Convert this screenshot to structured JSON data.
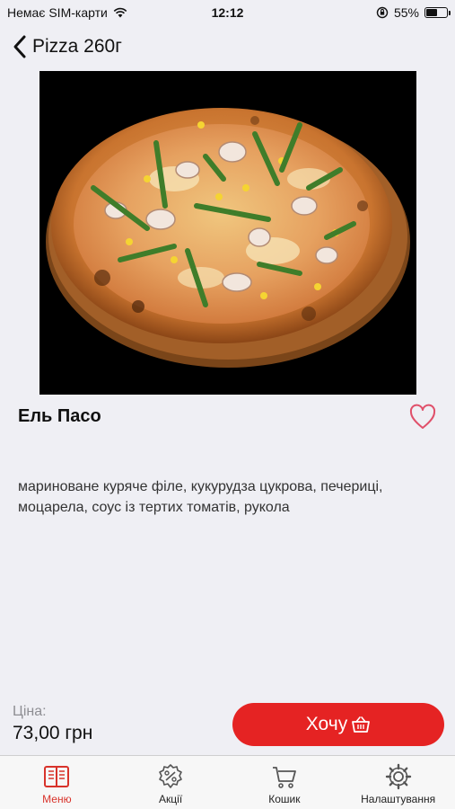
{
  "status_bar": {
    "carrier": "Немає SIM-карти",
    "time": "12:12",
    "battery": "55%",
    "battery_level": 0.55,
    "icons": [
      "wifi-icon",
      "orientation-lock-icon",
      "battery-icon"
    ]
  },
  "nav": {
    "title": "Pizza 260г",
    "back_icon": "chevron-left-icon"
  },
  "product": {
    "name": "Ель Пасо",
    "description": "мариноване куряче філе, кукурудза цукрова, печериці, моцарела, соус із тертих томатів, рукола",
    "favorite_icon": "heart-outline-icon",
    "image": "pizza-photo"
  },
  "price": {
    "label": "Ціна:",
    "value": "73,00 грн"
  },
  "cta": {
    "label": "Хочу",
    "icon": "basket-icon"
  },
  "tabs": [
    {
      "label": "Меню",
      "icon": "menu-book-icon",
      "active": true
    },
    {
      "label": "Акції",
      "icon": "discount-badge-icon",
      "active": false
    },
    {
      "label": "Кошик",
      "icon": "cart-icon",
      "active": false
    },
    {
      "label": "Налаштування",
      "icon": "gear-icon",
      "active": false
    }
  ],
  "colors": {
    "accent": "#e52323",
    "active_tab": "#d8332b",
    "background": "#efeff4"
  }
}
